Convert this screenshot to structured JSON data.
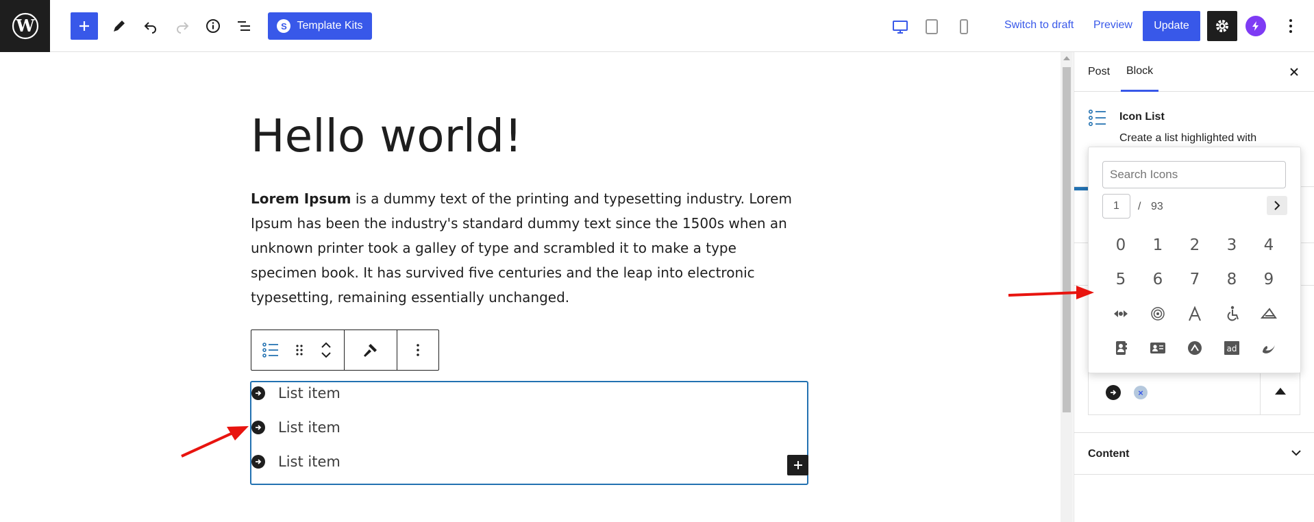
{
  "header": {
    "template_kits_label": "Template Kits",
    "switch_to_draft_label": "Switch to draft",
    "preview_label": "Preview",
    "update_label": "Update"
  },
  "editor": {
    "title": "Hello world!",
    "paragraph_bold": "Lorem Ipsum",
    "paragraph_rest": " is a dummy text of the printing and typesetting industry. Lorem Ipsum has been the industry's standard dummy text since the 1500s when an unknown printer took a galley of type and scrambled it to make a type specimen book. It has survived five centuries and the leap into electronic typesetting, remaining essentially unchanged.",
    "list_items": [
      "List item",
      "List item",
      "List item"
    ]
  },
  "sidebar": {
    "tabs": [
      "Post",
      "Block"
    ],
    "active_tab": "Block",
    "block_name": "Icon List",
    "block_description": "Create a list highlighted with",
    "content_panel_label": "Content"
  },
  "icon_picker": {
    "search_placeholder": "Search Icons",
    "current_page": "1",
    "page_separator": "/",
    "total_pages": "93",
    "icons": [
      "0",
      "1",
      "2",
      "3",
      "4",
      "5",
      "6",
      "7",
      "8",
      "9",
      "500px-icon",
      "five-hundred-px-icon",
      "font-a-icon",
      "accessible-icon",
      "accusoft-icon",
      "address-book-icon",
      "address-card-icon",
      "adn-icon",
      "ad-icon",
      "adversal-icon"
    ]
  },
  "colors": {
    "accent": "#3858e9",
    "selection": "#2271b1",
    "annotation": "#e8140f"
  }
}
